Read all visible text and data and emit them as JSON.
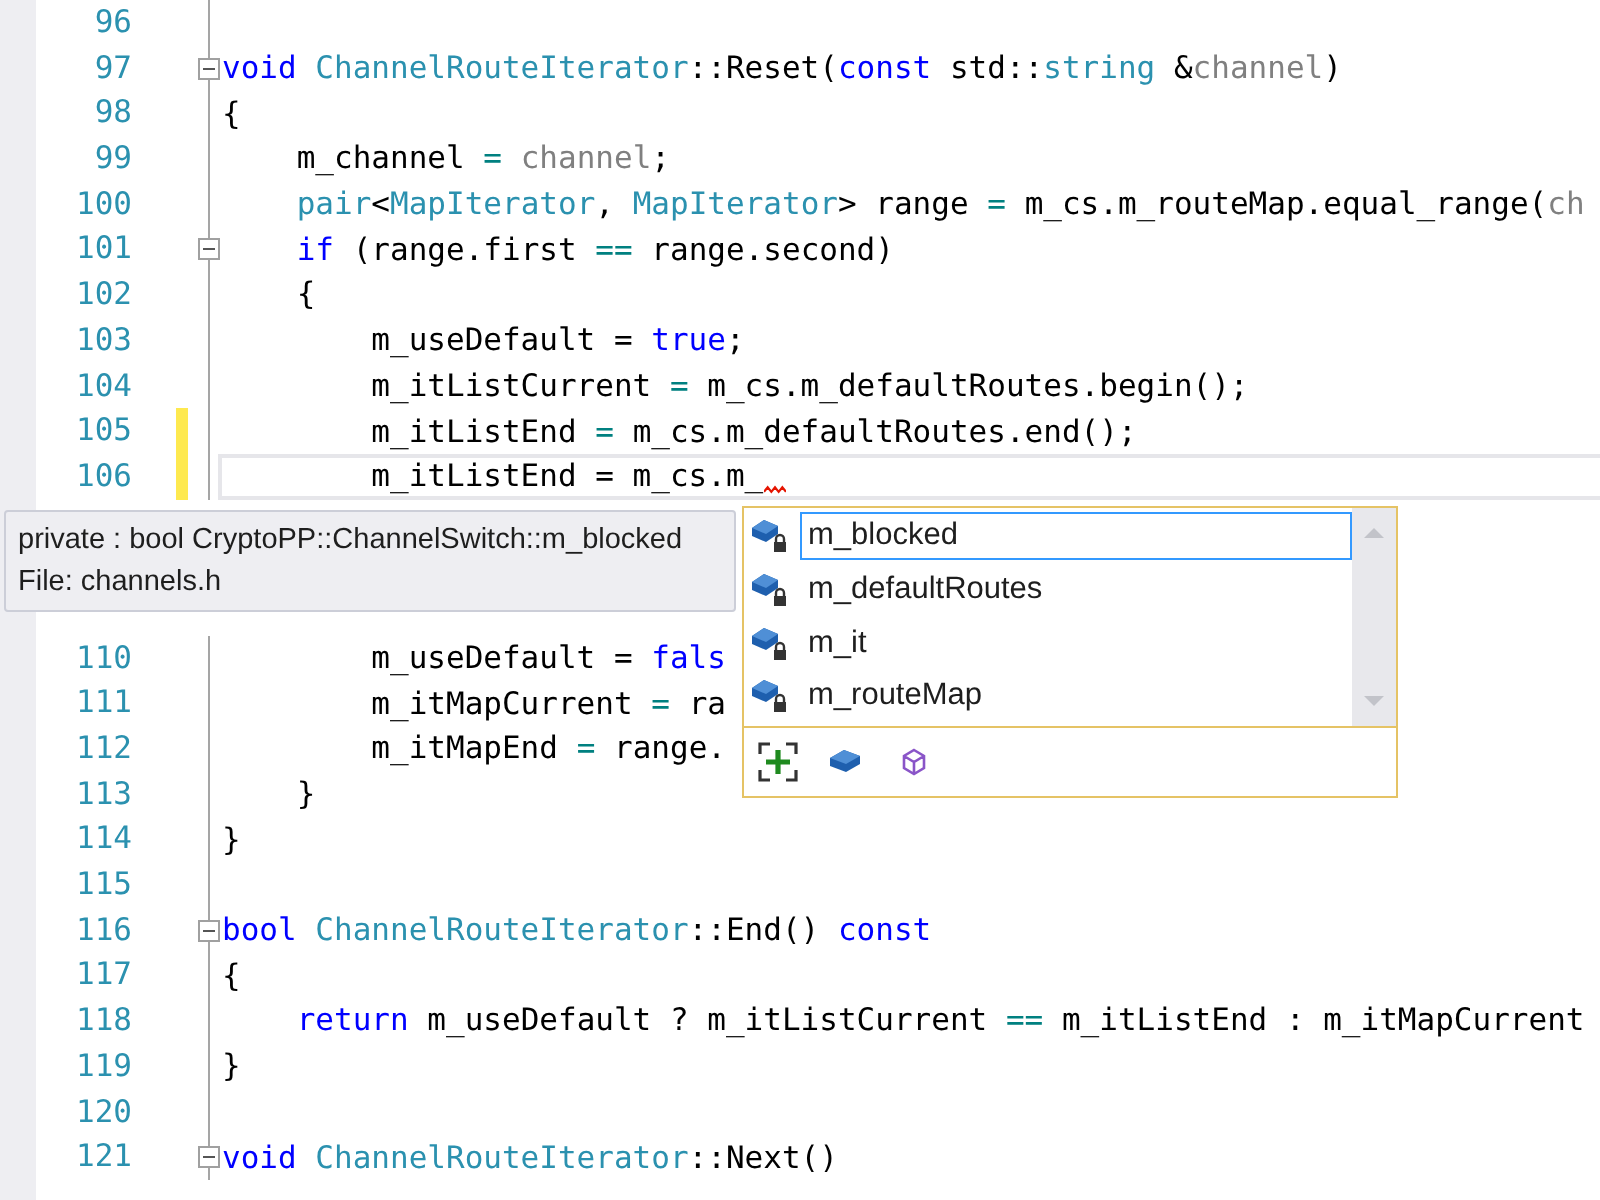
{
  "editor": {
    "lines": [
      {
        "number": "96",
        "fold": false,
        "changed": false,
        "current": false,
        "error": false
      },
      {
        "number": "97",
        "fold": true,
        "changed": false,
        "current": false,
        "error": false,
        "tokens": [
          {
            "text": "void",
            "kind": "keyword"
          },
          {
            "text": " ChannelRouteIterator",
            "kind": "type"
          },
          {
            "text": "::Reset(",
            "kind": "plain"
          },
          {
            "text": "const",
            "kind": "keyword"
          },
          {
            "text": " std::",
            "kind": "plain"
          },
          {
            "text": "string",
            "kind": "type"
          },
          {
            "text": " &",
            "kind": "plain"
          },
          {
            "text": "channel",
            "kind": "param"
          },
          {
            "text": ")",
            "kind": "plain"
          }
        ]
      },
      {
        "number": "98",
        "fold": false,
        "changed": false,
        "current": false,
        "error": false,
        "tokens": [
          {
            "text": "{",
            "kind": "plain"
          }
        ]
      },
      {
        "number": "99",
        "fold": false,
        "changed": false,
        "current": false,
        "error": false,
        "tokens": [
          {
            "text": "    m_channel ",
            "kind": "plain"
          },
          {
            "text": "= ",
            "kind": "op"
          },
          {
            "text": "channel",
            "kind": "param"
          },
          {
            "text": ";",
            "kind": "plain"
          }
        ]
      },
      {
        "number": "100",
        "fold": false,
        "changed": false,
        "current": false,
        "error": false,
        "tokens": [
          {
            "text": "    pair",
            "kind": "type"
          },
          {
            "text": "<",
            "kind": "plain"
          },
          {
            "text": "MapIterator",
            "kind": "type"
          },
          {
            "text": ", ",
            "kind": "plain"
          },
          {
            "text": "MapIterator",
            "kind": "type"
          },
          {
            "text": "> range ",
            "kind": "plain"
          },
          {
            "text": "=",
            "kind": "op"
          },
          {
            "text": " m_cs.m_routeMap.equal_range(",
            "kind": "plain"
          },
          {
            "text": "ch",
            "kind": "param"
          }
        ]
      },
      {
        "number": "101",
        "fold": true,
        "changed": false,
        "current": false,
        "error": false,
        "tokens": [
          {
            "text": "    if",
            "kind": "keyword"
          },
          {
            "text": " (range.first ",
            "kind": "plain"
          },
          {
            "text": "==",
            "kind": "op"
          },
          {
            "text": " range.second)",
            "kind": "plain"
          }
        ]
      },
      {
        "number": "102",
        "fold": false,
        "changed": false,
        "current": false,
        "error": false,
        "tokens": [
          {
            "text": "    {",
            "kind": "plain"
          }
        ]
      },
      {
        "number": "103",
        "fold": false,
        "changed": false,
        "current": false,
        "error": false,
        "tokens": [
          {
            "text": "        m_useDefault = ",
            "kind": "plain"
          },
          {
            "text": "true",
            "kind": "keyword"
          },
          {
            "text": ";",
            "kind": "plain"
          }
        ]
      },
      {
        "number": "104",
        "fold": false,
        "changed": false,
        "current": false,
        "error": false,
        "tokens": [
          {
            "text": "        m_itListCurrent ",
            "kind": "plain"
          },
          {
            "text": "=",
            "kind": "op"
          },
          {
            "text": " m_cs.m_defaultRoutes.begin();",
            "kind": "plain"
          }
        ]
      },
      {
        "number": "105",
        "fold": false,
        "changed": true,
        "current": false,
        "error": false,
        "tokens": [
          {
            "text": "        m_itListEnd ",
            "kind": "plain"
          },
          {
            "text": "=",
            "kind": "op"
          },
          {
            "text": " m_cs.m_defaultRoutes.end();",
            "kind": "plain"
          }
        ]
      },
      {
        "number": "106",
        "fold": false,
        "changed": true,
        "current": true,
        "error": true,
        "tokens": [
          {
            "text": "        m_itListEnd = m_cs.m_",
            "kind": "plain"
          }
        ]
      },
      {
        "kind": "covered"
      },
      {
        "kind": "covered"
      },
      {
        "kind": "covered"
      },
      {
        "number": "110",
        "fold": false,
        "changed": false,
        "current": false,
        "error": false,
        "tokens": [
          {
            "text": "        m_useDefault = ",
            "kind": "plain"
          },
          {
            "text": "fals",
            "kind": "keyword"
          }
        ]
      },
      {
        "number": "111",
        "fold": false,
        "changed": false,
        "current": false,
        "error": false,
        "tokens": [
          {
            "text": "        m_itMapCurrent ",
            "kind": "plain"
          },
          {
            "text": "=",
            "kind": "op"
          },
          {
            "text": " ra",
            "kind": "plain"
          }
        ]
      },
      {
        "number": "112",
        "fold": false,
        "changed": false,
        "current": false,
        "error": false,
        "tokens": [
          {
            "text": "        m_itMapEnd ",
            "kind": "plain"
          },
          {
            "text": "=",
            "kind": "op"
          },
          {
            "text": " range.",
            "kind": "plain"
          }
        ]
      },
      {
        "number": "113",
        "fold": false,
        "changed": false,
        "current": false,
        "error": false,
        "tokens": [
          {
            "text": "    }",
            "kind": "plain"
          }
        ]
      },
      {
        "number": "114",
        "fold": false,
        "changed": false,
        "current": false,
        "error": false,
        "tokens": [
          {
            "text": "}",
            "kind": "plain"
          }
        ]
      },
      {
        "number": "115",
        "fold": false,
        "changed": false,
        "current": false,
        "error": false
      },
      {
        "number": "116",
        "fold": true,
        "changed": false,
        "current": false,
        "error": false,
        "tokens": [
          {
            "text": "bool",
            "kind": "keyword"
          },
          {
            "text": " ChannelRouteIterator",
            "kind": "type"
          },
          {
            "text": "::End() ",
            "kind": "plain"
          },
          {
            "text": "const",
            "kind": "keyword"
          }
        ]
      },
      {
        "number": "117",
        "fold": false,
        "changed": false,
        "current": false,
        "error": false,
        "tokens": [
          {
            "text": "{",
            "kind": "plain"
          }
        ]
      },
      {
        "number": "118",
        "fold": false,
        "changed": false,
        "current": false,
        "error": false,
        "tokens": [
          {
            "text": "    return",
            "kind": "keyword"
          },
          {
            "text": " m_useDefault ? m_itListCurrent ",
            "kind": "plain"
          },
          {
            "text": "==",
            "kind": "op"
          },
          {
            "text": " m_itListEnd : m_itMapCurrent",
            "kind": "plain"
          }
        ]
      },
      {
        "number": "119",
        "fold": false,
        "changed": false,
        "current": false,
        "error": false,
        "tokens": [
          {
            "text": "}",
            "kind": "plain"
          }
        ]
      },
      {
        "number": "120",
        "fold": false,
        "changed": false,
        "current": false,
        "error": false
      },
      {
        "number": "121",
        "fold": true,
        "changed": false,
        "current": false,
        "error": false,
        "tokens": [
          {
            "text": "void",
            "kind": "keyword"
          },
          {
            "text": " ChannelRouteIterator",
            "kind": "type"
          },
          {
            "text": "::Next()",
            "kind": "plain"
          }
        ]
      }
    ]
  },
  "tooltip": {
    "signature": "private : bool CryptoPP::ChannelSwitch::m_blocked",
    "file": "File: channels.h"
  },
  "completion": {
    "items": [
      {
        "label": "m_blocked",
        "selected": true
      },
      {
        "label": "m_defaultRoutes",
        "selected": false
      },
      {
        "label": "m_it",
        "selected": false
      },
      {
        "label": "m_routeMap",
        "selected": false
      }
    ]
  }
}
